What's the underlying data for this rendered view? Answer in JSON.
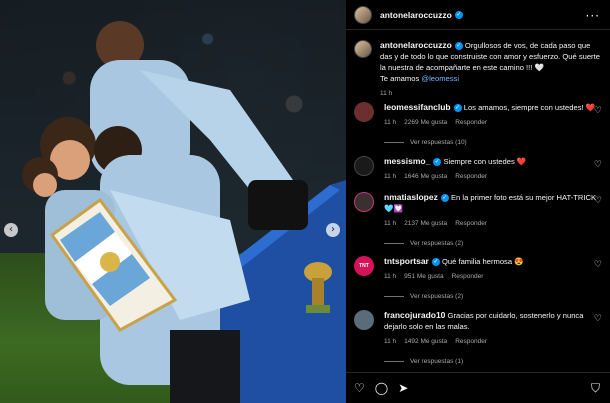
{
  "post": {
    "username": "antonelaroccuzzo",
    "caption_text": "Orgullosos de vos, de cada paso que das y de todo lo que construiste con amor y esfuerzo. Qué suerte la nuestra de acompañarte en este camino !!! 🤍 ",
    "caption_line2": "Te amamos ",
    "caption_mention": "@leomessi",
    "time": "11 h"
  },
  "icons": {
    "more": "more-options-icon",
    "verified": "verified-badge-icon",
    "heart": "heart-icon",
    "comment": "comment-icon",
    "share": "share-icon",
    "bookmark": "bookmark-icon",
    "prev": "chevron-left-icon",
    "next": "chevron-right-icon"
  },
  "comments": [
    {
      "user": "leomessifanclub",
      "verified": true,
      "text": "Los amamos, siempre con ustedes! ❤️",
      "time": "11 h",
      "likes": "2269 Me gusta",
      "reply": "Responder",
      "replies": "Ver respuestas (10)",
      "avatar_color": "#6b2f2f"
    },
    {
      "user": "messismo_",
      "verified": true,
      "text": "Siempre con ustedes ❤️",
      "time": "11 h",
      "likes": "1646 Me gusta",
      "reply": "Responder",
      "replies": "",
      "avatar_color": "#1a1a1a"
    },
    {
      "user": "nmatiaslopez",
      "verified": true,
      "text": "En la primer foto está su mejor HAT-TRICK 🩵💟",
      "time": "11 h",
      "likes": "2137 Me gusta",
      "reply": "Responder",
      "replies": "Ver respuestas (2)",
      "avatar_color": "#3a3030"
    },
    {
      "user": "tntsportsar",
      "verified": true,
      "text": "Qué familia hermosa 😍",
      "time": "11 h",
      "likes": "951 Me gusta",
      "reply": "Responder",
      "replies": "Ver respuestas (2)",
      "avatar_color": "#d4145a"
    },
    {
      "user": "francojurado10",
      "verified": false,
      "text": "Gracias por cuidarlo, sostenerlo y nunca dejarlo solo en las malas.",
      "time": "11 h",
      "likes": "1492 Me gusta",
      "reply": "Responder",
      "replies": "Ver respuestas (1)",
      "avatar_color": "#5a6b7a"
    }
  ],
  "colors": {
    "accent_blue": "#0095f6",
    "mention": "#7ab6ff",
    "meta_gray": "#a8a8a8"
  }
}
